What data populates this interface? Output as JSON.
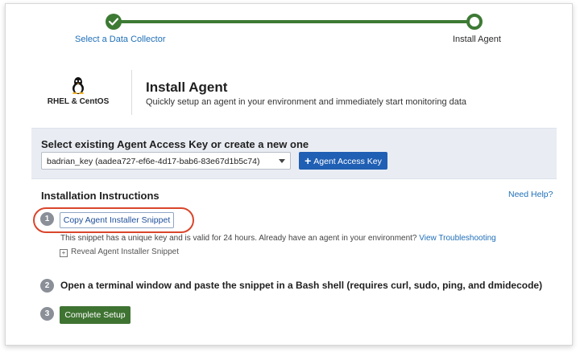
{
  "stepper": {
    "steps": [
      {
        "label": "Select a Data Collector",
        "state": "complete"
      },
      {
        "label": "Install Agent",
        "state": "current"
      }
    ],
    "accent_color": "#3d7a34"
  },
  "header": {
    "os_label": "RHEL & CentOS",
    "os_icon": "linux-penguin-icon",
    "title": "Install Agent",
    "subtitle": "Quickly setup an agent in your environment and immediately start monitoring data"
  },
  "access_key": {
    "heading": "Select existing Agent Access Key or create a new one",
    "selected_value": "badrian_key (aadea727-ef6e-4d17-bab6-83e67d1b5c74)",
    "add_button_label": "Agent Access Key",
    "add_button_color": "#1f5fb4"
  },
  "instructions": {
    "heading": "Installation Instructions",
    "help_link": "Need Help?",
    "step1": {
      "number": "1",
      "button_label": "Copy Agent Installer Snippet",
      "note": "This snippet has a unique key and is valid for 24 hours. Already have an agent in your environment?",
      "note_link": "View Troubleshooting",
      "reveal_label": "Reveal Agent Installer Snippet"
    },
    "step2": {
      "number": "2",
      "text": "Open a terminal window and paste the snippet in a Bash shell (requires curl, sudo, ping, and dmidecode)"
    },
    "step3": {
      "number": "3",
      "button_label": "Complete Setup",
      "button_color": "#3f7332"
    },
    "highlight_color": "#d9452b"
  }
}
